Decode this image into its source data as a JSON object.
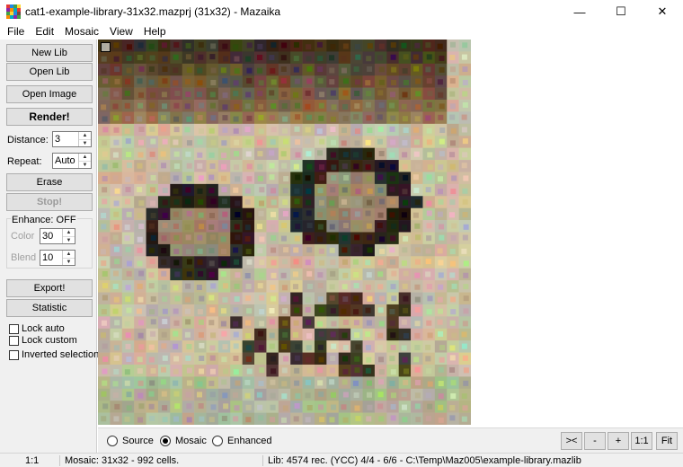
{
  "window": {
    "title": "cat1-example-library-31x32.mazprj (31x32) - Mazaika",
    "controls": {
      "minimize": "—",
      "maximize": "☐",
      "close": "✕"
    }
  },
  "menu": [
    "File",
    "Edit",
    "Mosaic",
    "View",
    "Help"
  ],
  "left_panel": {
    "new_lib": "New Lib",
    "open_lib": "Open Lib",
    "open_image": "Open Image",
    "render": "Render!",
    "distance_label": "Distance:",
    "distance_value": "3",
    "repeat_label": "Repeat:",
    "repeat_value": "Auto",
    "erase": "Erase",
    "stop": "Stop!",
    "enhance_label": "Enhance: OFF",
    "color_label": "Color",
    "color_value": "30",
    "blend_label": "Blend",
    "blend_value": "10",
    "export": "Export!",
    "statistic": "Statistic",
    "lock_auto": "Lock auto",
    "lock_custom": "Lock custom",
    "inverted_selection": "Inverted selection"
  },
  "view_modes": {
    "source": "Source",
    "mosaic": "Mosaic",
    "enhanced": "Enhanced",
    "selected": "mosaic"
  },
  "zoom_buttons": {
    "shrink": "><",
    "minus": "-",
    "plus": "+",
    "one_to_one": "1:1",
    "fit": "Fit"
  },
  "status": {
    "zoom": "1:1",
    "mosaic_info": "Mosaic: 31x32 - 992 cells.",
    "lib_info": "Lib: 4574 rec. (YCC) 4/4 - 6/6 - C:\\Temp\\Maz005\\example-library.mazlib"
  },
  "mosaic_grid": {
    "cols": 31,
    "rows": 32
  }
}
